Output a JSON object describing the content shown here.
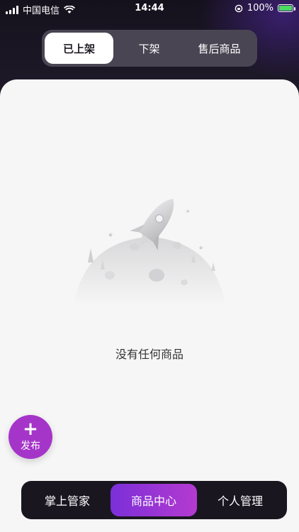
{
  "status_bar": {
    "carrier": "中国电信",
    "time": "14:44",
    "battery": "100%"
  },
  "tabs": [
    {
      "label": "已上架",
      "active": true
    },
    {
      "label": "下架",
      "active": false
    },
    {
      "label": "售后商品",
      "active": false
    }
  ],
  "empty_state": {
    "message": "没有任何商品",
    "icon": "rocket-moon-illustration"
  },
  "fab": {
    "icon": "plus-icon",
    "label": "发布"
  },
  "bottom_nav": [
    {
      "label": "掌上管家",
      "active": false
    },
    {
      "label": "商品中心",
      "active": true
    },
    {
      "label": "个人管理",
      "active": false
    }
  ],
  "colors": {
    "accent": "#a535c9",
    "nav_active_start": "#7b2fd8",
    "nav_active_end": "#b43ad0",
    "background_dark": "#1a1620",
    "card": "#f6f6f6"
  }
}
